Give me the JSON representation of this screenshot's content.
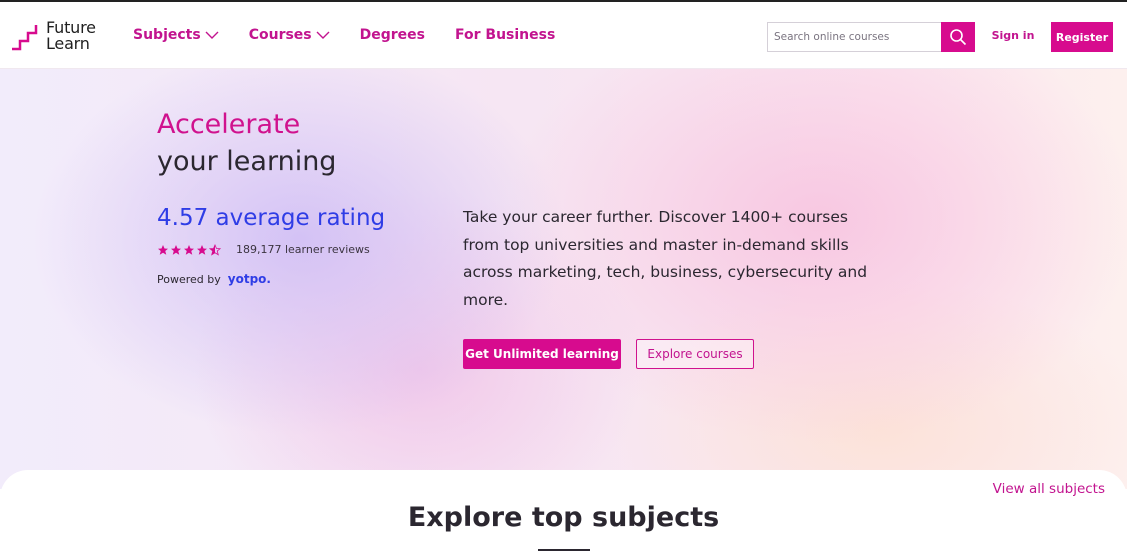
{
  "header": {
    "logo": {
      "line1": "Future",
      "line2": "Learn"
    },
    "nav": [
      {
        "label": "Subjects",
        "has_dropdown": true
      },
      {
        "label": "Courses",
        "has_dropdown": true
      },
      {
        "label": "Degrees",
        "has_dropdown": false
      },
      {
        "label": "For Business",
        "has_dropdown": false
      }
    ],
    "search": {
      "placeholder": "Search online courses",
      "icon": "search-icon"
    },
    "sign_in": "Sign in",
    "register": "Register"
  },
  "hero": {
    "headline_accent": "Accelerate",
    "headline_rest": "your learning",
    "rating_text": "4.57 average rating",
    "stars": 4.5,
    "reviews": "189,177 learner reviews",
    "powered_by": "Powered by",
    "powered_brand": "yotpo.",
    "description": "Take your career further. Discover 1400+ courses from top universities and master in-demand skills across marketing, tech, business, cybersecurity and more.",
    "cta_primary": "Get Unlimited learning",
    "cta_secondary": "Explore courses"
  },
  "subjects": {
    "view_all": "View all subjects",
    "title": "Explore top subjects"
  },
  "colors": {
    "brand_pink": "#d70b8e",
    "link_pink": "#c2148f",
    "rating_blue": "#2f3de6",
    "text_dark": "#2b2730"
  }
}
